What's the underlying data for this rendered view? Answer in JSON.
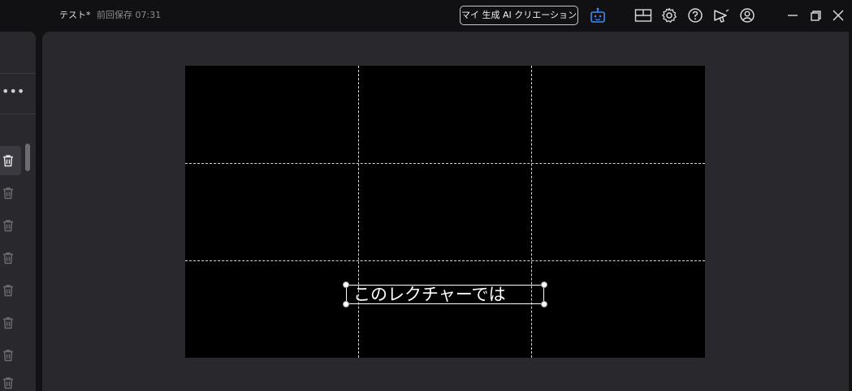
{
  "titlebar": {
    "doc_name": "テスト*",
    "saved_status": "前回保存 07:31",
    "ai_button_label": "マイ 生成 AI クリエーション"
  },
  "icons": {
    "robot": "robot-icon",
    "layout": "layout-icon",
    "settings": "gear-icon",
    "help": "help-icon",
    "announce": "megaphone-icon",
    "account": "account-icon",
    "minimize": "minimize-icon",
    "restore": "restore-icon",
    "close": "close-icon"
  },
  "left_panel": {
    "more_label": "•••",
    "trash_count": 8
  },
  "canvas": {
    "caption_text": "このレクチャーでは"
  },
  "colors": {
    "accent": "#3d8bf5",
    "background": "#111114",
    "panel": "#28282d",
    "canvas": "#000000"
  }
}
